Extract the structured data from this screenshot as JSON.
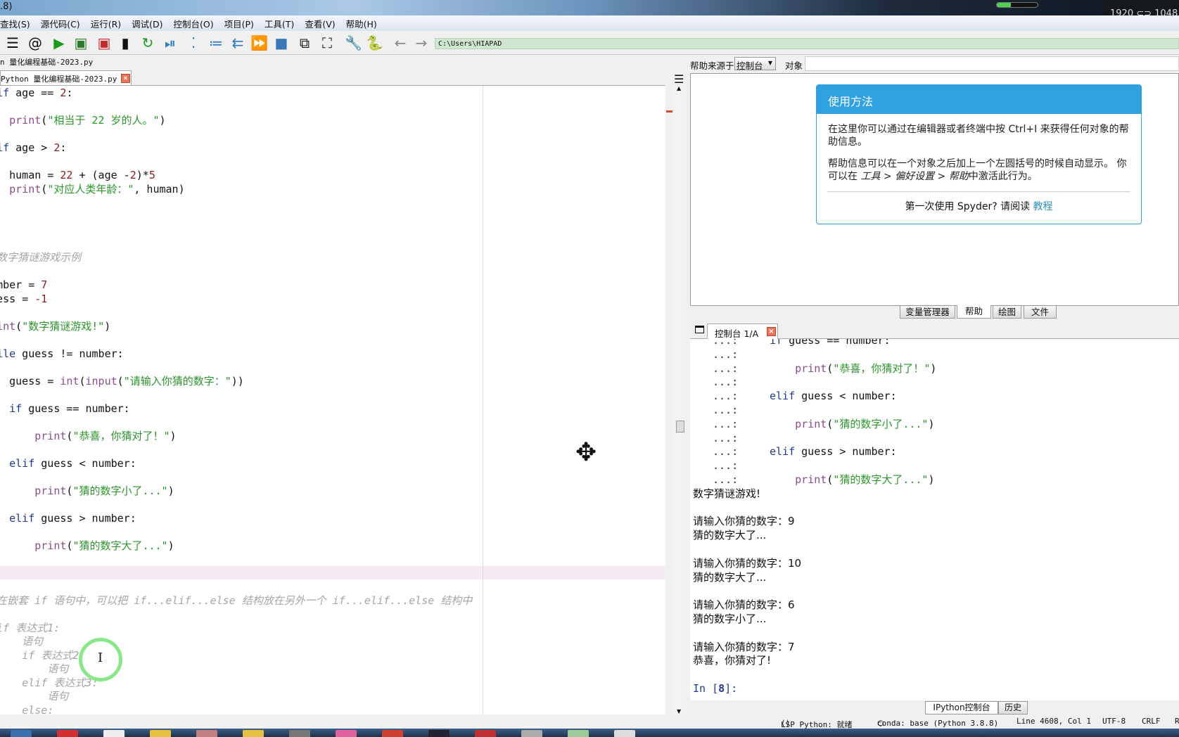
{
  "window": {
    "title_fragment": ".8)",
    "resolution": "1920 ⊂⊃ 1048",
    "progress": 0.35
  },
  "menu": [
    "查找(S)",
    "源代码(C)",
    "运行(R)",
    "调试(D)",
    "控制台(O)",
    "项目(P)",
    "工具(T)",
    "查看(V)",
    "帮助(H)"
  ],
  "toolbar": {
    "icons": [
      {
        "name": "outline-icon",
        "glyph": "☰",
        "color": "#111111"
      },
      {
        "name": "at-icon",
        "glyph": "@",
        "color": "#111111"
      },
      {
        "name": "run-icon",
        "glyph": "▶",
        "color": "#1e9a1e"
      },
      {
        "name": "run-cell-icon",
        "glyph": "▣",
        "color": "#2a7a2a"
      },
      {
        "name": "run-cell-advance-icon",
        "glyph": "▣",
        "color": "#c62828"
      },
      {
        "name": "run-selection-icon",
        "glyph": "▮",
        "color": "#111111"
      },
      {
        "name": "rerun-icon",
        "glyph": "↻",
        "color": "#1e9a1e"
      },
      {
        "name": "debug-icon",
        "glyph": "⏯",
        "color": "#2f7bbf"
      },
      {
        "name": "step-icon",
        "glyph": "⁚",
        "color": "#2f7bbf"
      },
      {
        "name": "step-into-icon",
        "glyph": "≔",
        "color": "#2f7bbf"
      },
      {
        "name": "step-return-icon",
        "glyph": "⇇",
        "color": "#2f7bbf"
      },
      {
        "name": "continue-icon",
        "glyph": "⏩",
        "color": "#2f7bbf"
      },
      {
        "name": "stop-icon",
        "glyph": "■",
        "color": "#3a78b8"
      },
      {
        "name": "maximize-pane-icon",
        "glyph": "⧉",
        "color": "#111111"
      },
      {
        "name": "fullscreen-icon",
        "glyph": "⛶",
        "color": "#111111"
      },
      {
        "name": "preferences-wrench-icon",
        "glyph": "🔧",
        "color": "#111111"
      },
      {
        "name": "pythonpath-icon",
        "glyph": "🐍",
        "color": "#d4a017"
      },
      {
        "name": "back-arrow-icon",
        "glyph": "←",
        "color": "#888888"
      },
      {
        "name": "forward-arrow-icon",
        "glyph": "→",
        "color": "#888888"
      }
    ],
    "path": "C:\\Users\\HIAPAD"
  },
  "editor": {
    "file_path": "n 量化编程基础-2023.py",
    "tab_label": "Python 量化编程基础-2023.py",
    "lines": [
      [
        [
          "elif",
          "kw"
        ],
        [
          " age == ",
          ""
        ],
        [
          "2",
          "num"
        ],
        [
          ":",
          ""
        ]
      ],
      [],
      [
        [
          "    ",
          ""
        ],
        [
          "print",
          "bi"
        ],
        [
          "(",
          ""
        ],
        [
          "\"相当于 22 岁的人。\"",
          "str"
        ],
        [
          ")",
          ""
        ]
      ],
      [],
      [
        [
          "elif",
          "kw"
        ],
        [
          " age > ",
          ""
        ],
        [
          "2",
          "num"
        ],
        [
          ":",
          ""
        ]
      ],
      [],
      [
        [
          "    human = ",
          ""
        ],
        [
          "22",
          "num"
        ],
        [
          " + (age -",
          ""
        ],
        [
          "2",
          "num"
        ],
        [
          ")*",
          ""
        ],
        [
          "5",
          "num"
        ]
      ],
      [
        [
          "    ",
          ""
        ],
        [
          "print",
          "bi"
        ],
        [
          "(",
          ""
        ],
        [
          "\"对应人类年龄：\"",
          "str"
        ],
        [
          ", human)",
          ""
        ]
      ],
      [],
      [],
      [],
      [],
      [
        [
          "# 数字猜谜游戏示例",
          "cm"
        ]
      ],
      [],
      [
        [
          "number = ",
          ""
        ],
        [
          "7",
          "num"
        ]
      ],
      [
        [
          "guess = ",
          ""
        ],
        [
          "-1",
          "num"
        ]
      ],
      [],
      [
        [
          "print",
          "bi"
        ],
        [
          "(",
          ""
        ],
        [
          "\"数字猜谜游戏!\"",
          "str"
        ],
        [
          ")",
          ""
        ]
      ],
      [],
      [
        [
          "while",
          "kw"
        ],
        [
          " guess != number:",
          ""
        ]
      ],
      [],
      [
        [
          "    guess = ",
          ""
        ],
        [
          "int",
          "bi"
        ],
        [
          "(",
          ""
        ],
        [
          "input",
          "bi"
        ],
        [
          "(",
          ""
        ],
        [
          "\"请输入你猜的数字：\"",
          "str"
        ],
        [
          "))",
          ""
        ]
      ],
      [],
      [
        [
          "    ",
          ""
        ],
        [
          "if",
          "kw"
        ],
        [
          " guess == number:",
          ""
        ]
      ],
      [],
      [
        [
          "        ",
          ""
        ],
        [
          "print",
          "bi"
        ],
        [
          "(",
          ""
        ],
        [
          "\"恭喜，你猜对了！\"",
          "str"
        ],
        [
          ")",
          ""
        ]
      ],
      [],
      [
        [
          "    ",
          ""
        ],
        [
          "elif",
          "kw"
        ],
        [
          " guess < number:",
          ""
        ]
      ],
      [],
      [
        [
          "        ",
          ""
        ],
        [
          "print",
          "bi"
        ],
        [
          "(",
          ""
        ],
        [
          "\"猜的数字小了...\"",
          "str"
        ],
        [
          ")",
          ""
        ]
      ],
      [],
      [
        [
          "    ",
          ""
        ],
        [
          "elif",
          "kw"
        ],
        [
          " guess > number:",
          ""
        ]
      ],
      [],
      [
        [
          "        ",
          ""
        ],
        [
          "print",
          "bi"
        ],
        [
          "(",
          ""
        ],
        [
          "\"猜的数字大了...\"",
          "str"
        ],
        [
          ")",
          ""
        ]
      ],
      [],
      [],
      [],
      [
        [
          "# 在嵌套 if 语句中，可以把 if...elif...else 结构放在另外一个 if...elif...else 结构中",
          "cm"
        ]
      ],
      [],
      [
        [
          "  if 表达式1:",
          "cm"
        ]
      ],
      [
        [
          "      语句",
          "cm"
        ]
      ],
      [
        [
          "      if 表达式2:",
          "cm"
        ]
      ],
      [
        [
          "          语句",
          "cm"
        ]
      ],
      [
        [
          "      elif 表达式3:",
          "cm"
        ]
      ],
      [
        [
          "          语句",
          "cm"
        ]
      ],
      [
        [
          "      else:",
          "cm"
        ]
      ]
    ]
  },
  "help": {
    "source_label": "帮助来源于",
    "source_value": "控制台",
    "object_label": "对象",
    "object_value": "",
    "card_title": "使用方法",
    "para1": "在这里你可以通过在编辑器或者终端中按 Ctrl+I 来获得任何对象的帮助信息。",
    "para2_a": "帮助信息可以在一个对象之后加上一个左圆括号的时候自动显示。 你可以在 ",
    "para2_em": "工具 > 偏好设置 > 帮助",
    "para2_b": "中激活此行为。",
    "footer_text": "第一次使用 Spyder? 请阅读 ",
    "footer_link": "教程",
    "accent": "#2fa0e0"
  },
  "pane_tabs": [
    {
      "label": "变量管理器",
      "selected": false
    },
    {
      "label": "帮助",
      "selected": true
    },
    {
      "label": "绘图",
      "selected": false
    },
    {
      "label": "文件",
      "selected": false
    }
  ],
  "console": {
    "tab_label": "控制台 1/A",
    "lines": [
      {
        "p": "...:",
        "t": [
          [
            "if",
            "kw"
          ],
          [
            " guess == number:",
            ""
          ]
        ]
      },
      {
        "p": "...:",
        "t": []
      },
      {
        "p": "...:",
        "t": [
          [
            "    ",
            ""
          ],
          [
            "print",
            "bi"
          ],
          [
            "(",
            ""
          ],
          [
            "\"恭喜，你猜对了！\"",
            "str"
          ],
          [
            ")",
            ""
          ]
        ]
      },
      {
        "p": "...:",
        "t": []
      },
      {
        "p": "...:",
        "t": [
          [
            "elif",
            "kw"
          ],
          [
            " guess < number:",
            ""
          ]
        ]
      },
      {
        "p": "...:",
        "t": []
      },
      {
        "p": "...:",
        "t": [
          [
            "    ",
            ""
          ],
          [
            "print",
            "bi"
          ],
          [
            "(",
            ""
          ],
          [
            "\"猜的数字小了...\"",
            "str"
          ],
          [
            ")",
            ""
          ]
        ]
      },
      {
        "p": "...:",
        "t": []
      },
      {
        "p": "...:",
        "t": [
          [
            "elif",
            "kw"
          ],
          [
            " guess > number:",
            ""
          ]
        ]
      },
      {
        "p": "...:",
        "t": []
      },
      {
        "p": "...:",
        "t": [
          [
            "    ",
            ""
          ],
          [
            "print",
            "bi"
          ],
          [
            "(",
            ""
          ],
          [
            "\"猜的数字大了...\"",
            "str"
          ],
          [
            ")",
            ""
          ]
        ]
      },
      {
        "o": "数字猜谜游戏!"
      },
      {
        "o": ""
      },
      {
        "o": "请输入你猜的数字：9"
      },
      {
        "o": "猜的数字大了..."
      },
      {
        "o": ""
      },
      {
        "o": "请输入你猜的数字：10"
      },
      {
        "o": "猜的数字大了..."
      },
      {
        "o": ""
      },
      {
        "o": "请输入你猜的数字：6"
      },
      {
        "o": "猜的数字小了..."
      },
      {
        "o": ""
      },
      {
        "o": "请输入你猜的数字：7"
      },
      {
        "o": "恭喜，你猜对了!"
      },
      {
        "o": ""
      }
    ],
    "in_prompt_a": "In [",
    "in_prompt_num": "8",
    "in_prompt_b": "]:"
  },
  "bottom_tabs": [
    {
      "label": "IPython控制台",
      "selected": true
    },
    {
      "label": "历史",
      "selected": false
    }
  ],
  "status": {
    "lsp": "LSP Python: 就绪",
    "conda": "conda: base (Python 3.8.8)",
    "position": "Line 4608, Col 1",
    "encoding": "UTF-8",
    "eol": "CRLF",
    "extra": "R"
  }
}
